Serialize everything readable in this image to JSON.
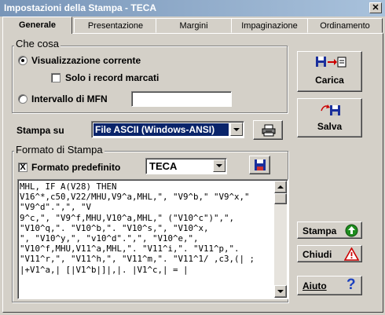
{
  "window": {
    "title": "Impostazioni della Stampa - TECA",
    "close_glyph": "✕"
  },
  "tabs": [
    {
      "label": "Generale",
      "active": true
    },
    {
      "label": "Presentazione",
      "active": false
    },
    {
      "label": "Margini",
      "active": false
    },
    {
      "label": "Impaginazione",
      "active": false
    },
    {
      "label": "Ordinamento",
      "active": false
    }
  ],
  "che_cosa": {
    "legend": "Che cosa",
    "option_current": {
      "label": "Visualizzazione corrente",
      "selected": true
    },
    "only_marked": {
      "label": "Solo i record marcati",
      "checked": false
    },
    "option_mfn": {
      "label": "Intervallo di MFN",
      "selected": false,
      "value": ""
    }
  },
  "stampa_su": {
    "label": "Stampa su",
    "value": "File ASCII (Windows-ANSI)"
  },
  "formato": {
    "legend": "Formato di Stampa",
    "predefinito": {
      "label": "Formato predefinito",
      "checked": true,
      "mark": "X"
    },
    "format_value": "TECA",
    "code": "MHL, IF A(V28) THEN\nV16^*,c50,V22/MHU,V9^a,MHL,\", \"V9^b,\" \"V9^x,\"\n\"V9^d\".\",\", \"V\n9^c,\", \"V9^f,MHU,V10^a,MHL,\" (\"V10^c\")\",\",\n\"V10^q,\". \"V10^b,\". \"V10^s,\", \"V10^x,\n\", \"V10^y,\", \"v10^d\".\",\", \"V10^e,\",\n\"V10^f,MHU,V11^a,MHL,\". \"V11^i,\". \"V11^p,\".\n\"V11^r,\", \"V11^h,\", \"V11^m,\". \"V11^1/ ,c3,(| ;\n|+V1^a,| [|V1^b|]|,|. |V1^c,| = |"
  },
  "buttons": {
    "carica": "Carica",
    "salva": "Salva",
    "stampa": "Stampa",
    "chiudi": "Chiudi",
    "aiuto": "Aiuto"
  },
  "colors": {
    "stampa_icon": "#1e8c1e",
    "chiudi_icon": "#cc0000",
    "aiuto_icon": "#1a3fbf",
    "disk_icon": "#1a2f9c"
  }
}
